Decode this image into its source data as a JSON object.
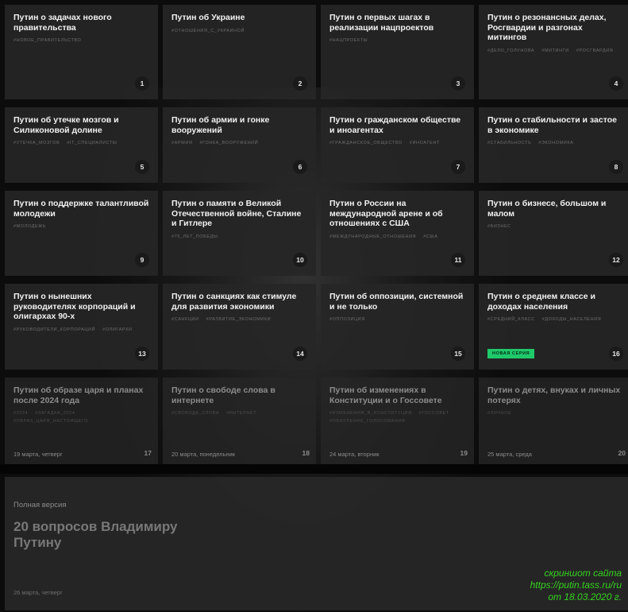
{
  "cards": [
    {
      "title": "Путин о задачах нового правительства",
      "tags": [
        "#НОВОЕ_ПРАВИТЕЛЬСТВО"
      ],
      "num": "1"
    },
    {
      "title": "Путин об Украине",
      "tags": [
        "#ОТНОШЕНИЯ_С_УКРАИНОЙ"
      ],
      "num": "2"
    },
    {
      "title": "Путин о первых шагах в реализации нацпроектов",
      "tags": [
        "#НАЦПРОЕКТЫ"
      ],
      "num": "3"
    },
    {
      "title": "Путин о резонансных делах, Росгвардии и разгонах митингов",
      "tags": [
        "#ДЕЛО_ГОЛУНОВА",
        "#МИТИНГИ",
        "#РОСГВАРДИЯ"
      ],
      "num": "4"
    },
    {
      "title": "Путин об утечке мозгов и Силиконовой долине",
      "tags": [
        "#УТЕЧКА_МОЗГОВ",
        "#IT_СПЕЦИАЛИСТЫ"
      ],
      "num": "5"
    },
    {
      "title": "Путин об армии и гонке вооружений",
      "tags": [
        "#АРМИЯ",
        "#ГОНКА_ВООРУЖЕНИЙ"
      ],
      "num": "6"
    },
    {
      "title": "Путин о гражданском обществе и иноагентах",
      "tags": [
        "#ГРАЖДАНСКОЕ_ОБЩЕСТВО",
        "#ИНОАГЕНТ"
      ],
      "num": "7"
    },
    {
      "title": "Путин о стабильности и застое в экономике",
      "tags": [
        "#СТАБИЛЬНОСТЬ",
        "#ЭКОНОМИКА"
      ],
      "num": "8"
    },
    {
      "title": "Путин о поддержке талантливой молодежи",
      "tags": [
        "#МОЛОДЕЖЬ"
      ],
      "num": "9"
    },
    {
      "title": "Путин о памяти о Великой Отечественной войне, Сталине и Гитлере",
      "tags": [
        "#75_ЛЕТ_ПОБЕДЫ"
      ],
      "num": "10"
    },
    {
      "title": "Путин о России на международной арене и об отношениях с США",
      "tags": [
        "#МЕЖДУНАРОДНЫЕ_ОТНОШЕНИЯ",
        "#США"
      ],
      "num": "11"
    },
    {
      "title": "Путин о бизнесе, большом и малом",
      "tags": [
        "#БИЗНЕС"
      ],
      "num": "12"
    },
    {
      "title": "Путин о нынешних руководителях корпораций и олигархах 90-х",
      "tags": [
        "#РУКОВОДИТЕЛИ_КОРПОРАЦИЙ",
        "#ОЛИГАРХИ"
      ],
      "num": "13"
    },
    {
      "title": "Путин о санкциях как стимуле для развития экономики",
      "tags": [
        "#САНКЦИИ",
        "#РАЗВИТИЕ_ЭКОНОМИКИ"
      ],
      "num": "14"
    },
    {
      "title": "Путин об оппозиции, системной и не только",
      "tags": [
        "#ОППОЗИЦИЯ"
      ],
      "num": "15"
    },
    {
      "title": "Путин о среднем классе и доходах населения",
      "tags": [
        "#СРЕДНИЙ_КЛАСС",
        "#ДОХОДЫ_НАСЕЛЕНИЯ"
      ],
      "num": "16",
      "badge": "НОВАЯ СЕРИЯ"
    },
    {
      "title": "Путин об образе царя и планах после 2024 года",
      "tags": [
        "#2024",
        "#ЗАГАДКА_2024",
        "#ОБРАЗ_ЦАРЯ_НАСТОЯЩЕГО"
      ],
      "num": "17",
      "date": "19 марта, четверг"
    },
    {
      "title": "Путин о свободе слова в интернете",
      "tags": [
        "#СВОБОДА_СЛОВА",
        "#ИНТЕРНЕТ"
      ],
      "num": "18",
      "date": "20 марта, понедельник"
    },
    {
      "title": "Путин об изменениях в Конституции и о Госсовете",
      "tags": [
        "#ИЗМЕНЕНИЯ_В_КОНСТИТУЦИЯ",
        "#ГОССОВЕТ",
        "#ОБНУЛЕНИЕ_ГОЛОСОВАНИЯ"
      ],
      "num": "19",
      "date": "24 марта, вторник"
    },
    {
      "title": "Путин о детях, внуках и личных потерях",
      "tags": [
        "#ЛИЧНОЕ"
      ],
      "num": "20",
      "date": "25 марта, среда"
    }
  ],
  "hero": {
    "kicker": "Полная версия",
    "title": "20 вопросов Владимиру Путину",
    "date": "26 марта, четверг"
  },
  "caption": {
    "line1": "скриншот сайта",
    "line2": "https://putin.tass.ru/ru",
    "line3": "от 18.03.2020 г."
  }
}
